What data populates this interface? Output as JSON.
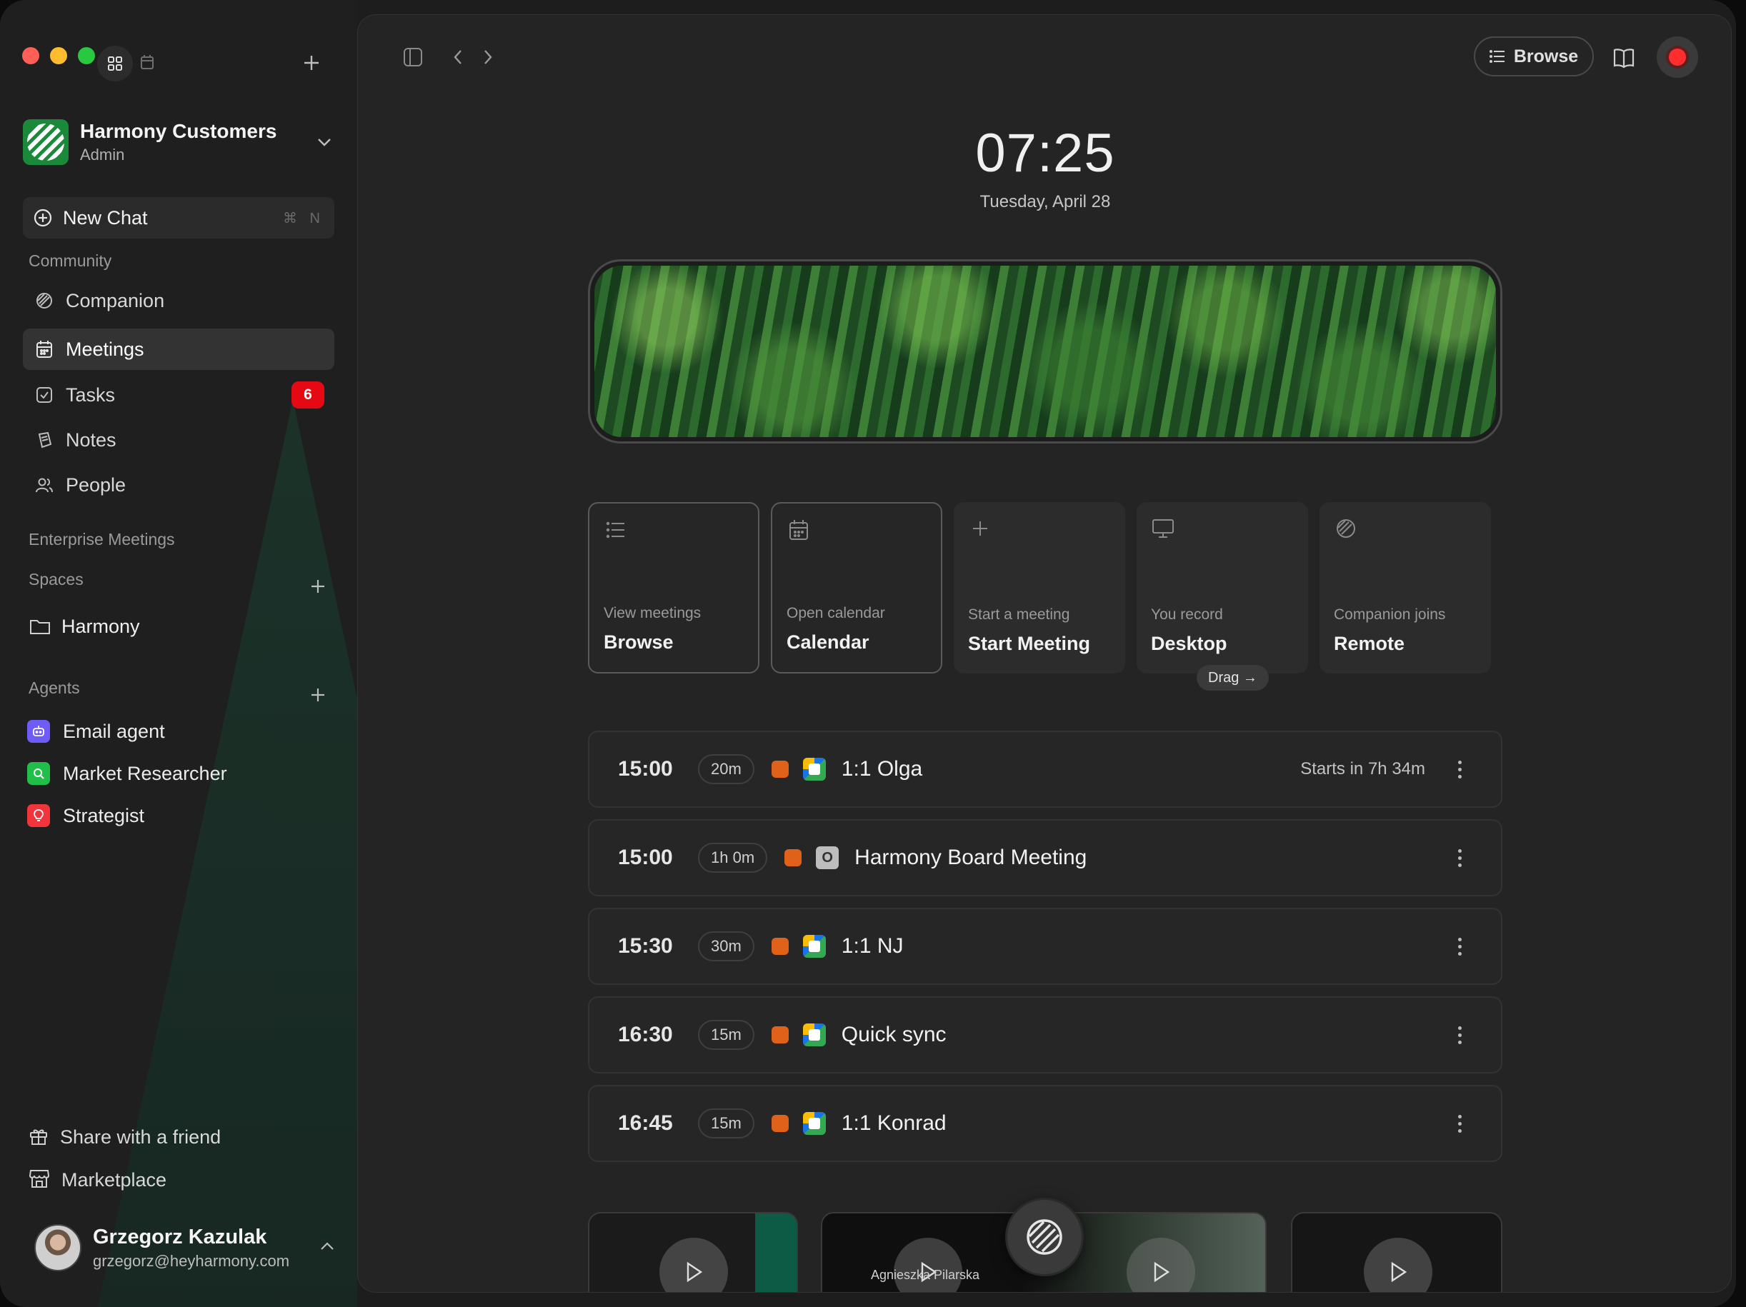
{
  "sidebar": {
    "workspace": {
      "name": "Harmony Customers",
      "role": "Admin"
    },
    "new_chat": {
      "label": "New Chat",
      "shortcut": "⌘ N"
    },
    "community_label": "Community",
    "nav": [
      {
        "label": "Companion",
        "icon": "companion-icon"
      },
      {
        "label": "Meetings",
        "icon": "calendar-icon",
        "active": true
      },
      {
        "label": "Tasks",
        "icon": "checkbox-icon",
        "badge": "6"
      },
      {
        "label": "Notes",
        "icon": "notes-icon"
      },
      {
        "label": "People",
        "icon": "people-icon"
      }
    ],
    "enterprise_label": "Enterprise Meetings",
    "spaces_label": "Spaces",
    "spaces": [
      {
        "label": "Harmony",
        "icon": "folder-icon"
      }
    ],
    "agents_label": "Agents",
    "agents": [
      {
        "label": "Email agent",
        "color": "#6e5cf6",
        "icon": "robot-icon"
      },
      {
        "label": "Market Researcher",
        "color": "#1fbf4a",
        "icon": "search-icon"
      },
      {
        "label": "Strategist",
        "color": "#f0363c",
        "icon": "lightbulb-icon"
      }
    ],
    "footer": [
      {
        "label": "Share with a friend",
        "icon": "gift-icon"
      },
      {
        "label": "Marketplace",
        "icon": "store-icon"
      }
    ],
    "user": {
      "name": "Grzegorz Kazulak",
      "email": "grzegorz@heyharmony.com"
    }
  },
  "toolbar": {
    "browse_label": "Browse"
  },
  "home": {
    "time": "07:25",
    "date": "Tuesday, April 28"
  },
  "cards": [
    {
      "sub": "View meetings",
      "title": "Browse",
      "icon": "list-icon",
      "outlined": true
    },
    {
      "sub": "Open calendar",
      "title": "Calendar",
      "icon": "calendar-icon",
      "outlined": true
    },
    {
      "sub": "Start a meeting",
      "title": "Start Meeting",
      "icon": "plus-icon"
    },
    {
      "sub": "You record",
      "title": "Desktop",
      "icon": "monitor-icon"
    },
    {
      "sub": "Companion joins",
      "title": "Remote",
      "icon": "companion-icon"
    }
  ],
  "drag_label": "Drag →",
  "meetings": [
    {
      "time": "15:00",
      "duration": "20m",
      "app": "google-meet",
      "title": "1:1 Olga",
      "starts": "Starts in 7h 34m"
    },
    {
      "time": "15:00",
      "duration": "1h 0m",
      "app": "outlook",
      "title": "Harmony Board Meeting",
      "starts": ""
    },
    {
      "time": "15:30",
      "duration": "30m",
      "app": "google-meet",
      "title": "1:1 NJ",
      "starts": ""
    },
    {
      "time": "16:30",
      "duration": "15m",
      "app": "google-meet",
      "title": "Quick sync",
      "starts": ""
    },
    {
      "time": "16:45",
      "duration": "15m",
      "app": "google-meet",
      "title": "1:1 Konrad",
      "starts": ""
    }
  ],
  "recordings": [
    {
      "name": ""
    },
    {
      "name": "Agnieszka Pilarska"
    },
    {
      "name": ""
    }
  ],
  "colors": {
    "accent_red": "#ff2d2d",
    "badge": "#e50914",
    "meeting_dot": "#e0621a"
  }
}
